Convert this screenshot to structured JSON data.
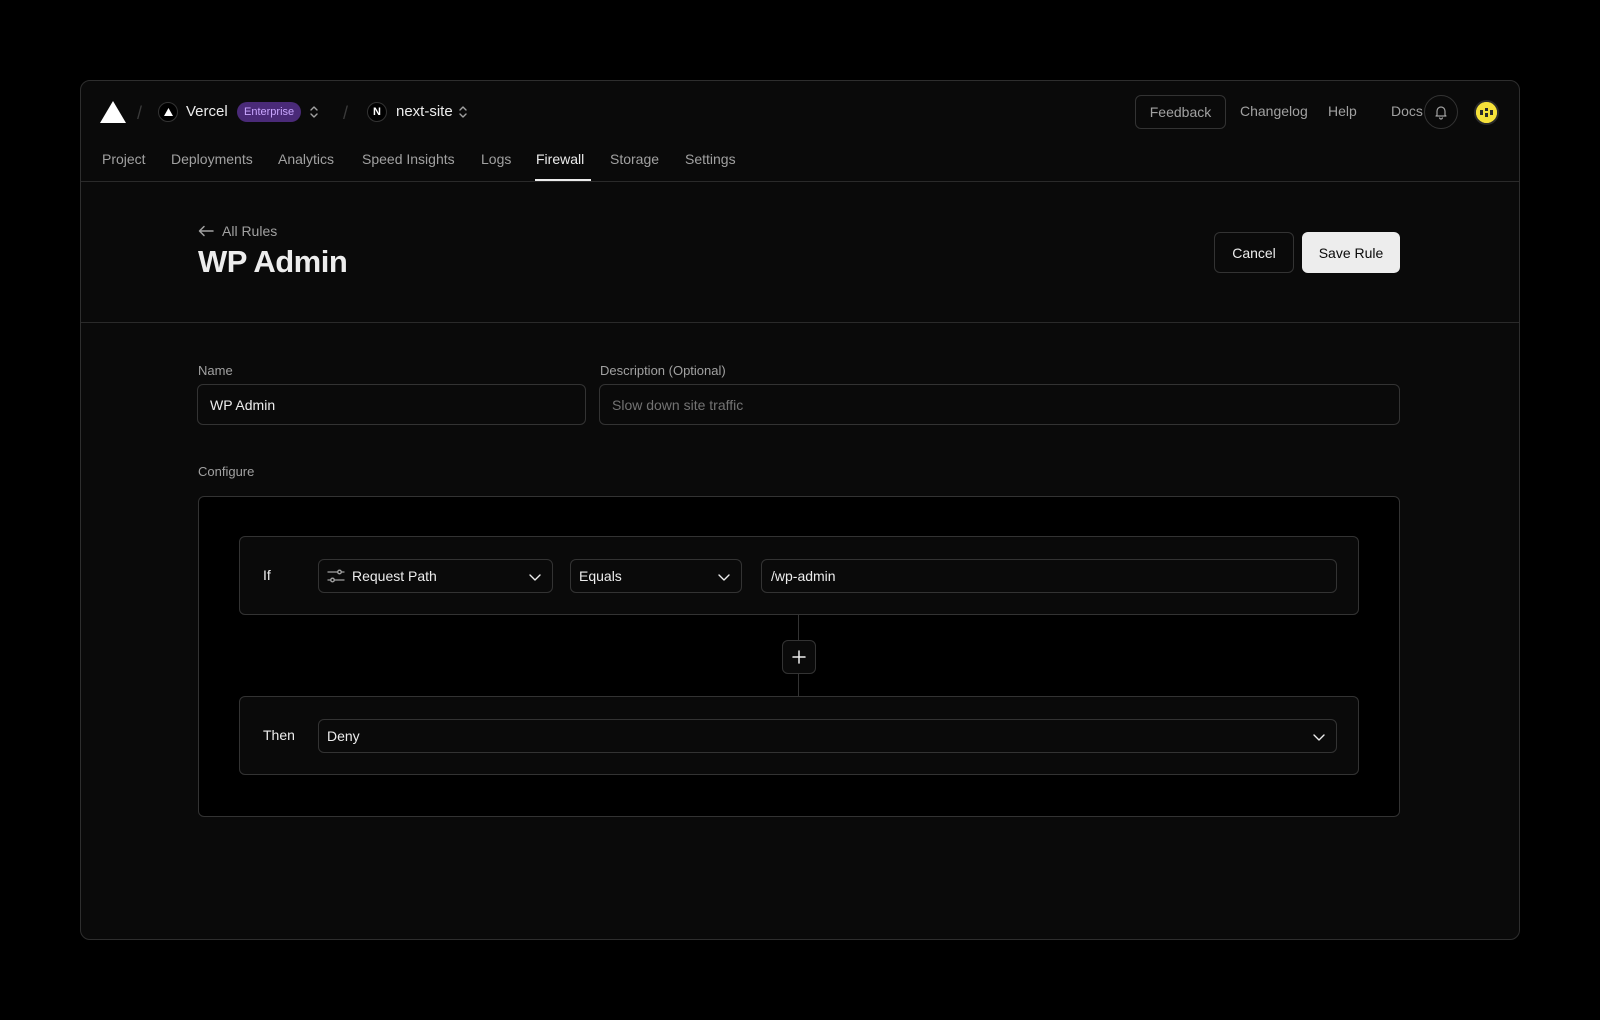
{
  "topbar": {
    "team": {
      "name": "Vercel",
      "badge": "Enterprise"
    },
    "project": {
      "initial": "N",
      "name": "next-site"
    },
    "feedback_label": "Feedback",
    "links": [
      "Changelog",
      "Help",
      "Docs"
    ]
  },
  "tabs": [
    "Project",
    "Deployments",
    "Analytics",
    "Speed Insights",
    "Logs",
    "Firewall",
    "Storage",
    "Settings"
  ],
  "active_tab": "Firewall",
  "header": {
    "back_label": "All Rules",
    "title": "WP Admin",
    "cancel_label": "Cancel",
    "save_label": "Save Rule"
  },
  "form": {
    "name_label": "Name",
    "name_value": "WP Admin",
    "description_label": "Description (Optional)",
    "description_placeholder": "Slow down site traffic",
    "configure_label": "Configure",
    "if_label": "If",
    "condition_field": "Request Path",
    "operator": "Equals",
    "condition_value": "/wp-admin",
    "then_label": "Then",
    "action": "Deny"
  },
  "colors": {
    "background": "#0a0a0a",
    "border": "#333333",
    "badge_bg": "#4a2a78",
    "badge_text": "#c9a6ff",
    "primary_button": "#ededed",
    "avatar": "#f5e13a"
  }
}
